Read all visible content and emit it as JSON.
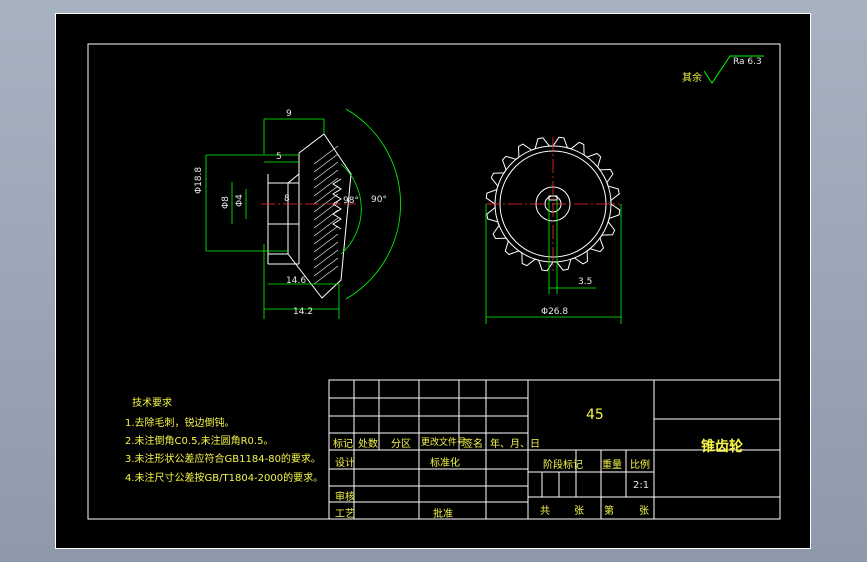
{
  "colors": {
    "frame": "#ffffff",
    "outline": "#ffffff",
    "dimension": "#00ff00",
    "centerline": "#ff2a2a",
    "hatch": "#ffffff",
    "text": "#f5f54a"
  },
  "roughness": {
    "prefix": "其余",
    "value": "Ra 6.3"
  },
  "section_view": {
    "dims": {
      "top": "9",
      "five": "5",
      "d_outer": "Φ18.8",
      "d_hub": "Φ8",
      "d_bore": "Φ4",
      "bore_len": "8",
      "angle_inner": "98°",
      "angle_outer": "90°",
      "len_inner": "14.6",
      "len_total": "14.2"
    }
  },
  "front_view": {
    "dims": {
      "key": "3.5",
      "d_tip": "Φ26.8"
    },
    "teeth": 20
  },
  "tech_req": {
    "heading": "技术要求",
    "items": [
      "1.去除毛刺，锐边倒钝。",
      "2.未注倒角C0.5,未注圆角R0.5。",
      "3.未注形状公差应符合GB1184-80的要求。",
      "4.未注尺寸公差按GB/T1804-2000的要求。"
    ]
  },
  "title_block": {
    "material": "45",
    "part_name": "锥齿轮",
    "rev_headers": [
      "标记",
      "处数",
      "分区",
      "更改文件号",
      "签名",
      "年、月、日"
    ],
    "design": "设计",
    "standardize": "标准化",
    "review": "审核",
    "process": "工艺",
    "approve": "批准",
    "stage_mark": "阶段标记",
    "weight": "重量",
    "scale_label": "比例",
    "scale_value": "2:1",
    "sheet_total": "共",
    "sheet_unit1": "张",
    "sheet_no": "第",
    "sheet_unit2": "张"
  }
}
